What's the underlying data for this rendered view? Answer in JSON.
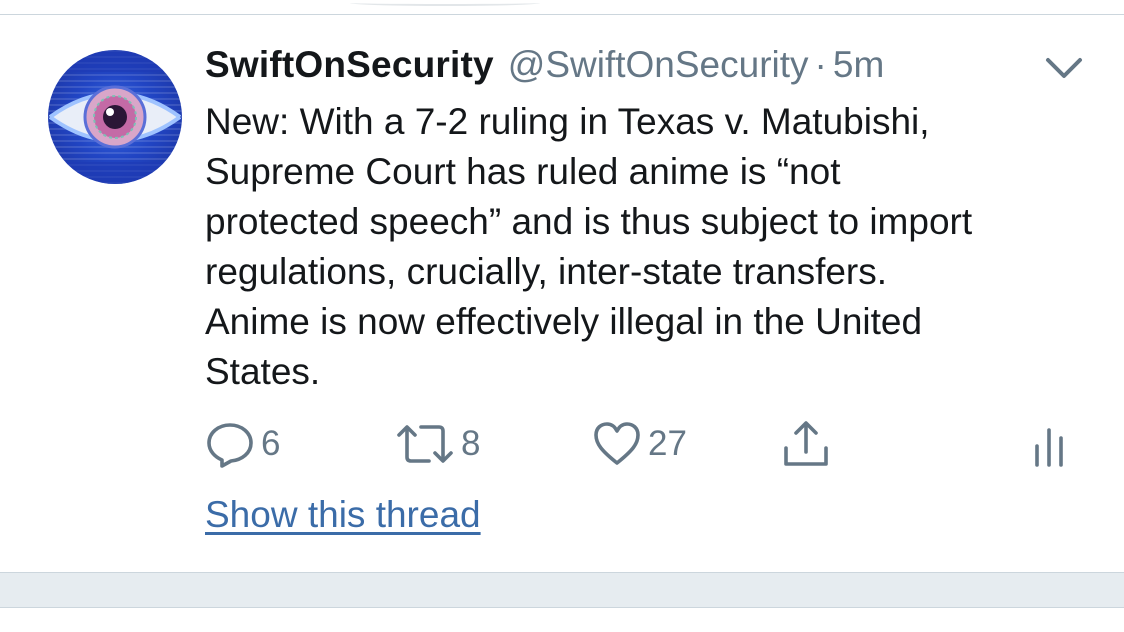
{
  "tweet": {
    "display_name": "SwiftOnSecurity",
    "handle": "@SwiftOnSecurity",
    "separator": "·",
    "time": "5m",
    "text_lines": [
      "New: With a 7-2 ruling in Texas v. Matubishi,",
      "Supreme Court has ruled anime is “not",
      "protected speech” and is thus subject to import",
      "regulations, crucially, inter-state transfers.",
      "Anime is now effectively illegal in the United",
      "States."
    ],
    "actions": {
      "reply_count": "6",
      "retweet_count": "8",
      "like_count": "27"
    },
    "show_thread_label": "Show this thread"
  },
  "icons": {
    "avatar": "eye-avatar",
    "caret": "chevron-down-icon",
    "reply": "reply-icon",
    "retweet": "retweet-icon",
    "like": "heart-icon",
    "share": "share-icon",
    "analytics": "analytics-icon"
  },
  "colors": {
    "text": "#14171a",
    "secondary": "#657786",
    "link": "#3b6ca8",
    "divider": "#ccd6dd",
    "gap": "#e6ecf0"
  }
}
